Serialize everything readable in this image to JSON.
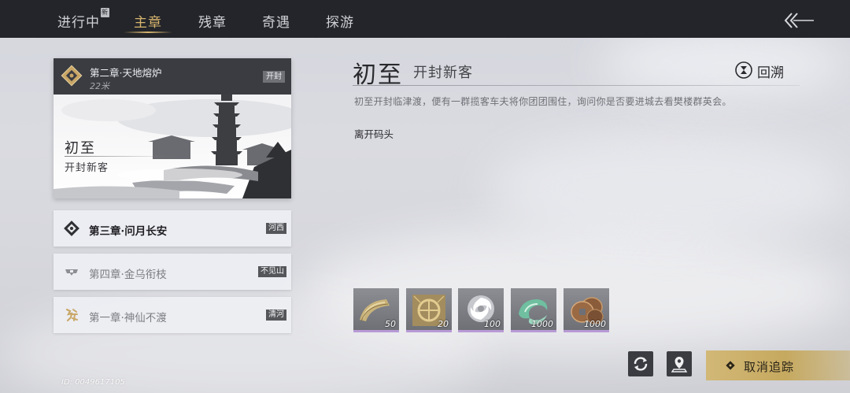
{
  "tabs": [
    {
      "label": "进行中",
      "badge": "新"
    },
    {
      "label": "主章"
    },
    {
      "label": "残章"
    },
    {
      "label": "奇遇"
    },
    {
      "label": "探游"
    }
  ],
  "active_chapter": {
    "title": "第二章·天地熔炉",
    "distance": "22米",
    "location_tag": "开封",
    "art_title": "初至",
    "art_subtitle": "开封新客"
  },
  "chapters": [
    {
      "label": "第三章·问月长安",
      "tag": "河西"
    },
    {
      "label": "第四章·金乌衔枝",
      "tag": "不见山"
    },
    {
      "label": "第一章·神仙不渡",
      "tag": "清河"
    }
  ],
  "quest": {
    "title": "初至",
    "subtitle": "开封新客",
    "rewind_label": "回溯",
    "description": "初至开封临津渡，便有一群揽客车夫将你团团围住，询问你是否要进城去看樊楼群英会。",
    "objective": "离开码头"
  },
  "rewards": [
    {
      "icon": "jade-pendant-icon",
      "count": "50"
    },
    {
      "icon": "gold-token-icon",
      "count": "20"
    },
    {
      "icon": "spirit-swirl-icon",
      "count": "100"
    },
    {
      "icon": "jade-wind-icon",
      "count": "1000"
    },
    {
      "icon": "copper-coins-icon",
      "count": "1000"
    }
  ],
  "footer": {
    "id_label": "ID: 0049617105",
    "cancel_label": "取消追踪"
  },
  "colors": {
    "accent_gold": "#d8b56e",
    "topbar": "#23252a",
    "rarity_purple": "#b89ad6"
  }
}
